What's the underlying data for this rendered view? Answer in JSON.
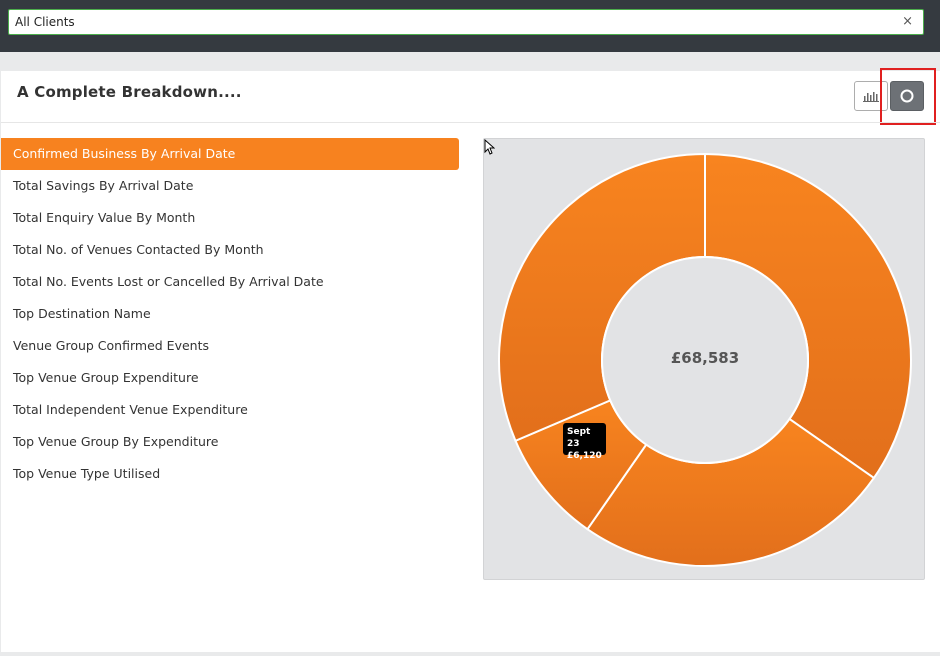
{
  "header": {
    "client_select_value": "All Clients",
    "clear_icon": "×"
  },
  "card": {
    "title": "A Complete Breakdown....",
    "view_buttons": [
      {
        "name": "bar-chart-view",
        "icon": "bar-chart-icon"
      },
      {
        "name": "donut-chart-view",
        "icon": "donut-icon",
        "active": true
      }
    ]
  },
  "menu": {
    "items": [
      {
        "label": "Confirmed Business By Arrival Date",
        "active": true
      },
      {
        "label": "Total Savings By Arrival Date"
      },
      {
        "label": "Total Enquiry Value By Month"
      },
      {
        "label": "Total No. of Venues Contacted By Month"
      },
      {
        "label": "Total No. Events Lost or Cancelled By Arrival Date"
      },
      {
        "label": "Top Destination Name"
      },
      {
        "label": "Venue Group Confirmed Events"
      },
      {
        "label": "Top Venue Group Expenditure"
      },
      {
        "label": "Total Independent Venue Expenditure"
      },
      {
        "label": "Top Venue Group By Expenditure"
      },
      {
        "label": "Top Venue Type Utilised"
      }
    ]
  },
  "chart_data": {
    "type": "pie",
    "style": "donut",
    "total_label": "£68,583",
    "color": "#f7821f",
    "slices": [
      {
        "label": "",
        "value": 23800
      },
      {
        "label": "",
        "value": 17120
      },
      {
        "label": "Sept 23",
        "value": 6120
      },
      {
        "label": "",
        "value": 21543
      }
    ],
    "tooltip": {
      "label": "Sept 23",
      "value": "£6,120"
    }
  }
}
